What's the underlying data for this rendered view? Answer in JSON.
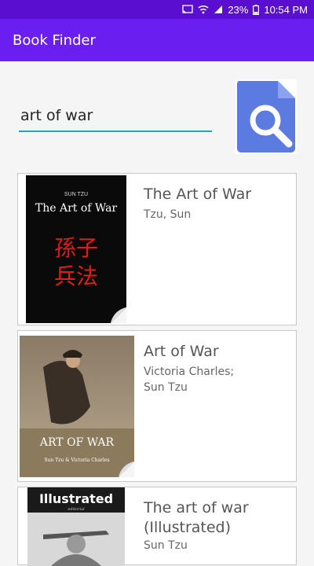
{
  "status_bar": {
    "battery": "23%",
    "time": "10:54 PM",
    "icons": [
      "cast-icon",
      "wifi-icon",
      "signal-icon",
      "battery-icon"
    ]
  },
  "app_bar": {
    "title": "Book Finder"
  },
  "search": {
    "value": "art of war",
    "button_icon": "search-document-icon"
  },
  "books": [
    {
      "title": "The Art of War",
      "authors": [
        "Tzu, Sun"
      ],
      "cover": {
        "top_text": "SUN TZU",
        "title_text": "The Art of War",
        "glyphs_line1": "孫子",
        "glyphs_line2": "兵法"
      }
    },
    {
      "title": "Art of War",
      "authors": [
        "Victoria Charles;",
        "Sun Tzu"
      ],
      "cover": {
        "title_text": "ART OF WAR",
        "byline": "Sun Tzu & Victoria Charles"
      }
    },
    {
      "title": "The art of war (Illustrated)",
      "authors": [
        "Sun Tzu"
      ],
      "cover": {
        "title_text": "Illustrated",
        "subtitle": "editorial"
      }
    }
  ],
  "colors": {
    "status_bar": "#5a0fd0",
    "app_bar": "#6a1ff0",
    "input_underline": "#1aa7b8",
    "search_button": "#5b7be0"
  }
}
